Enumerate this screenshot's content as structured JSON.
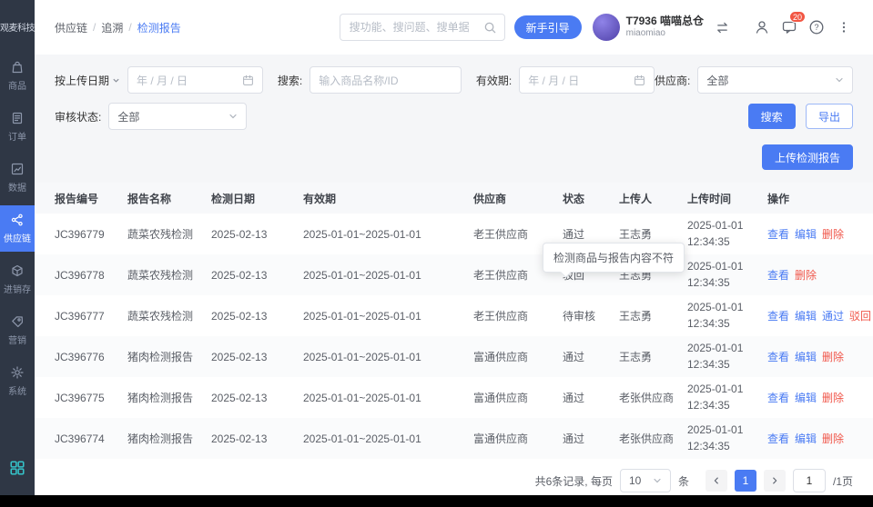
{
  "colors": {
    "accent": "#4a7bf3",
    "danger": "#f0564a",
    "sidebar_bg": "#2f3745",
    "panel_bg": "#f5f6f8"
  },
  "sidebar": {
    "logo": "观麦科技",
    "items": [
      {
        "label": "商品"
      },
      {
        "label": "订单"
      },
      {
        "label": "数据"
      },
      {
        "label": "供应链"
      },
      {
        "label": "进销存"
      },
      {
        "label": "营销"
      },
      {
        "label": "系统"
      }
    ]
  },
  "header": {
    "breadcrumb": {
      "items": [
        "供应链",
        "追溯",
        "检测报告"
      ],
      "sep": "/"
    },
    "search_placeholder": "搜功能、搜问题、搜单据",
    "guide_button": "新手引导",
    "account": {
      "name": "T7936 喵喵总仓",
      "sub": "miaomiao"
    },
    "chat_badge": "20"
  },
  "filters": {
    "date_label": "按上传日期",
    "date_placeholder": "年 / 月 / 日",
    "search_label": "搜索:",
    "search_placeholder": "输入商品名称/ID",
    "validity_label": "有效期:",
    "validity_placeholder": "年 / 月 / 日",
    "supplier_label": "供应商:",
    "supplier_value": "全部",
    "status_label": "审核状态:",
    "status_value": "全部",
    "search_button": "搜索",
    "export_button": "导出"
  },
  "toolbar": {
    "upload_button": "上传检测报告"
  },
  "tooltip": "检测商品与报告内容不符",
  "table": {
    "columns": [
      "报告编号",
      "报告名称",
      "检测日期",
      "有效期",
      "供应商",
      "状态",
      "上传人",
      "上传时间",
      "操作"
    ],
    "rows": [
      {
        "id": "JC396779",
        "name": "蔬菜农残检测",
        "date": "2025-02-13",
        "validity": "2025-01-01~2025-01-01",
        "supplier": "老王供应商",
        "status": "通过",
        "uploader": "王志勇",
        "time_date": "2025-01-01",
        "time_clock": "12:34:35",
        "actions": [
          {
            "label": "查看",
            "name": "view",
            "color": "blue"
          },
          {
            "label": "编辑",
            "name": "edit",
            "color": "blue"
          },
          {
            "label": "删除",
            "name": "delete",
            "color": "red"
          }
        ]
      },
      {
        "id": "JC396778",
        "name": "蔬菜农残检测",
        "date": "2025-02-13",
        "validity": "2025-01-01~2025-01-01",
        "supplier": "老王供应商",
        "status": "驳回",
        "uploader": "王志勇",
        "time_date": "2025-01-01",
        "time_clock": "12:34:35",
        "actions": [
          {
            "label": "查看",
            "name": "view",
            "color": "blue"
          },
          {
            "label": "删除",
            "name": "delete",
            "color": "red"
          }
        ]
      },
      {
        "id": "JC396777",
        "name": "蔬菜农残检测",
        "date": "2025-02-13",
        "validity": "2025-01-01~2025-01-01",
        "supplier": "老王供应商",
        "status": "待审核",
        "uploader": "王志勇",
        "time_date": "2025-01-01",
        "time_clock": "12:34:35",
        "actions": [
          {
            "label": "查看",
            "name": "view",
            "color": "blue"
          },
          {
            "label": "编辑",
            "name": "edit",
            "color": "blue"
          },
          {
            "label": "通过",
            "name": "approve",
            "color": "blue"
          },
          {
            "label": "驳回",
            "name": "reject",
            "color": "red"
          }
        ]
      },
      {
        "id": "JC396776",
        "name": "猪肉检测报告",
        "date": "2025-02-13",
        "validity": "2025-01-01~2025-01-01",
        "supplier": "富通供应商",
        "status": "通过",
        "uploader": "王志勇",
        "time_date": "2025-01-01",
        "time_clock": "12:34:35",
        "actions": [
          {
            "label": "查看",
            "name": "view",
            "color": "blue"
          },
          {
            "label": "编辑",
            "name": "edit",
            "color": "blue"
          },
          {
            "label": "删除",
            "name": "delete",
            "color": "red"
          }
        ]
      },
      {
        "id": "JC396775",
        "name": "猪肉检测报告",
        "date": "2025-02-13",
        "validity": "2025-01-01~2025-01-01",
        "supplier": "富通供应商",
        "status": "通过",
        "uploader": "老张供应商",
        "time_date": "2025-01-01",
        "time_clock": "12:34:35",
        "actions": [
          {
            "label": "查看",
            "name": "view",
            "color": "blue"
          },
          {
            "label": "编辑",
            "name": "edit",
            "color": "blue"
          },
          {
            "label": "删除",
            "name": "delete",
            "color": "red"
          }
        ]
      },
      {
        "id": "JC396774",
        "name": "猪肉检测报告",
        "date": "2025-02-13",
        "validity": "2025-01-01~2025-01-01",
        "supplier": "富通供应商",
        "status": "通过",
        "uploader": "老张供应商",
        "time_date": "2025-01-01",
        "time_clock": "12:34:35",
        "actions": [
          {
            "label": "查看",
            "name": "view",
            "color": "blue"
          },
          {
            "label": "编辑",
            "name": "edit",
            "color": "blue"
          },
          {
            "label": "删除",
            "name": "delete",
            "color": "red"
          }
        ]
      }
    ]
  },
  "pagination": {
    "summary": "共6条记录, 每页",
    "page_size": "10",
    "unit": "条",
    "current_page": "1",
    "jump_value": "1",
    "total_label": "/1页"
  }
}
